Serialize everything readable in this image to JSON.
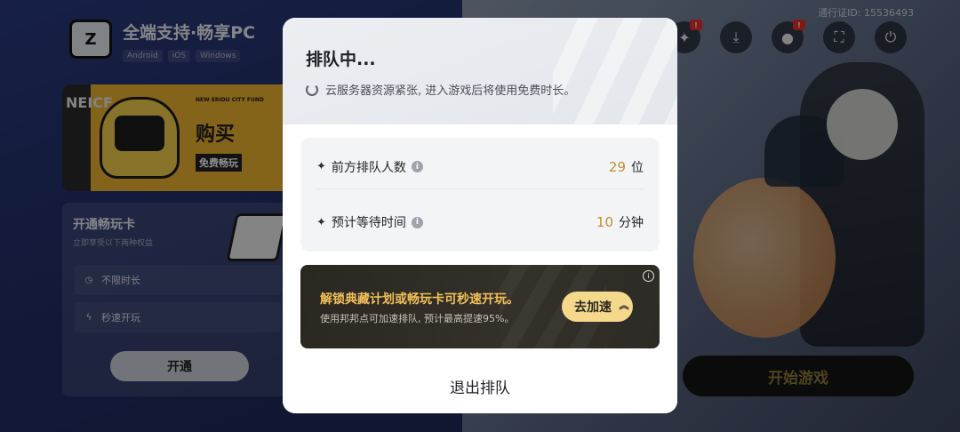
{
  "background": {
    "brand": {
      "title": "全端支持·畅享PC",
      "logo_text": "Z",
      "platforms": [
        "Android",
        "iOS",
        "Windows"
      ]
    },
    "banner": {
      "vertical_text": "NEICF",
      "small_text": "NEW ERIDU CITY FUND",
      "big_text": "购买",
      "sub_text": "免费畅玩"
    },
    "membership": {
      "title": "开通畅玩卡",
      "subtitle": "立即享受以下两种权益",
      "perks": [
        "不限时长",
        "秒速开玩"
      ],
      "open_button": "开通"
    },
    "pass_id": "通行证ID: 15536493",
    "top_icons": [
      {
        "name": "gift-icon",
        "badge": "!"
      },
      {
        "name": "download-icon",
        "badge": ""
      },
      {
        "name": "user-icon",
        "badge": "!"
      },
      {
        "name": "fullscreen-icon",
        "badge": ""
      },
      {
        "name": "power-icon",
        "badge": ""
      }
    ],
    "start_button": "开始游戏"
  },
  "modal": {
    "title": "排队中...",
    "notice": "云服务器资源紧张, 进入游戏后将使用免费时长。",
    "stats": [
      {
        "label": "前方排队人数",
        "value": "29",
        "unit": "位"
      },
      {
        "label": "预计等待时间",
        "value": "10",
        "unit": "分钟"
      }
    ],
    "promo": {
      "main": "解锁典藏计划或畅玩卡可秒速开玩。",
      "sub": "使用邦邦点可加速排队, 预计最高提速95%。",
      "button": "去加速"
    },
    "quit_label": "退出排队"
  }
}
